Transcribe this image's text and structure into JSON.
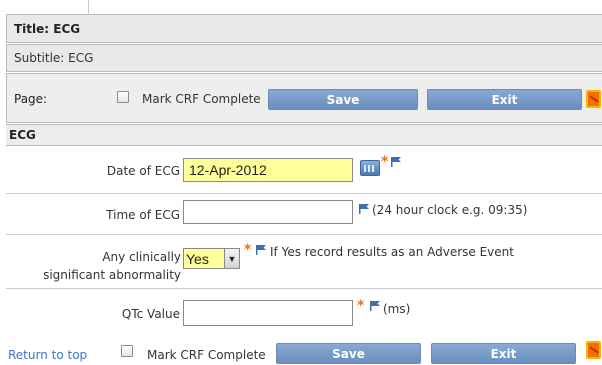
{
  "header": {
    "title": "Title: ECG",
    "subtitle": "Subtitle: ECG",
    "page_label": "Page:",
    "mark_complete_label": "Mark CRF Complete",
    "save_label": "Save",
    "exit_label": "Exit"
  },
  "section": {
    "title": "ECG"
  },
  "fields": {
    "date": {
      "label": "Date of ECG",
      "value": "12-Apr-2012"
    },
    "time": {
      "label": "Time of ECG",
      "value": "",
      "note": "(24 hour clock e.g. 09:35)"
    },
    "abnormality": {
      "label_line1": "Any clinically",
      "label_line2": "significant abnormality",
      "selected": "Yes",
      "note": "If Yes record results as an Adverse Event"
    },
    "qtc": {
      "label": "QTc Value",
      "value": "",
      "note": "(ms)"
    }
  },
  "footer": {
    "return_link": "Return to top",
    "mark_complete_label": "Mark CRF Complete",
    "save_label": "Save",
    "exit_label": "Exit"
  },
  "colors": {
    "button": "#7a9ccb",
    "required": "#ff6a00",
    "flag": "#3b6fb0",
    "highlight_field": "#ffff99"
  },
  "icons": [
    "calendar-icon",
    "flag-icon",
    "print-icon",
    "dropdown-arrow-icon"
  ]
}
